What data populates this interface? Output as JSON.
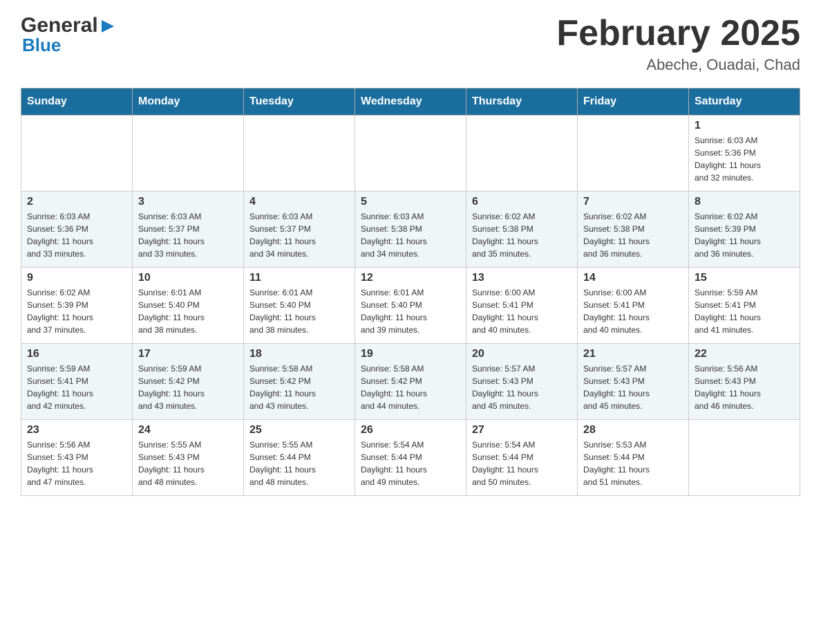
{
  "header": {
    "logo_general": "General",
    "logo_blue": "Blue",
    "title": "February 2025",
    "subtitle": "Abeche, Ouadai, Chad"
  },
  "days_of_week": [
    "Sunday",
    "Monday",
    "Tuesday",
    "Wednesday",
    "Thursday",
    "Friday",
    "Saturday"
  ],
  "weeks": [
    {
      "days": [
        {
          "number": "",
          "info": ""
        },
        {
          "number": "",
          "info": ""
        },
        {
          "number": "",
          "info": ""
        },
        {
          "number": "",
          "info": ""
        },
        {
          "number": "",
          "info": ""
        },
        {
          "number": "",
          "info": ""
        },
        {
          "number": "1",
          "info": "Sunrise: 6:03 AM\nSunset: 5:36 PM\nDaylight: 11 hours\nand 32 minutes."
        }
      ]
    },
    {
      "days": [
        {
          "number": "2",
          "info": "Sunrise: 6:03 AM\nSunset: 5:36 PM\nDaylight: 11 hours\nand 33 minutes."
        },
        {
          "number": "3",
          "info": "Sunrise: 6:03 AM\nSunset: 5:37 PM\nDaylight: 11 hours\nand 33 minutes."
        },
        {
          "number": "4",
          "info": "Sunrise: 6:03 AM\nSunset: 5:37 PM\nDaylight: 11 hours\nand 34 minutes."
        },
        {
          "number": "5",
          "info": "Sunrise: 6:03 AM\nSunset: 5:38 PM\nDaylight: 11 hours\nand 34 minutes."
        },
        {
          "number": "6",
          "info": "Sunrise: 6:02 AM\nSunset: 5:38 PM\nDaylight: 11 hours\nand 35 minutes."
        },
        {
          "number": "7",
          "info": "Sunrise: 6:02 AM\nSunset: 5:38 PM\nDaylight: 11 hours\nand 36 minutes."
        },
        {
          "number": "8",
          "info": "Sunrise: 6:02 AM\nSunset: 5:39 PM\nDaylight: 11 hours\nand 36 minutes."
        }
      ]
    },
    {
      "days": [
        {
          "number": "9",
          "info": "Sunrise: 6:02 AM\nSunset: 5:39 PM\nDaylight: 11 hours\nand 37 minutes."
        },
        {
          "number": "10",
          "info": "Sunrise: 6:01 AM\nSunset: 5:40 PM\nDaylight: 11 hours\nand 38 minutes."
        },
        {
          "number": "11",
          "info": "Sunrise: 6:01 AM\nSunset: 5:40 PM\nDaylight: 11 hours\nand 38 minutes."
        },
        {
          "number": "12",
          "info": "Sunrise: 6:01 AM\nSunset: 5:40 PM\nDaylight: 11 hours\nand 39 minutes."
        },
        {
          "number": "13",
          "info": "Sunrise: 6:00 AM\nSunset: 5:41 PM\nDaylight: 11 hours\nand 40 minutes."
        },
        {
          "number": "14",
          "info": "Sunrise: 6:00 AM\nSunset: 5:41 PM\nDaylight: 11 hours\nand 40 minutes."
        },
        {
          "number": "15",
          "info": "Sunrise: 5:59 AM\nSunset: 5:41 PM\nDaylight: 11 hours\nand 41 minutes."
        }
      ]
    },
    {
      "days": [
        {
          "number": "16",
          "info": "Sunrise: 5:59 AM\nSunset: 5:41 PM\nDaylight: 11 hours\nand 42 minutes."
        },
        {
          "number": "17",
          "info": "Sunrise: 5:59 AM\nSunset: 5:42 PM\nDaylight: 11 hours\nand 43 minutes."
        },
        {
          "number": "18",
          "info": "Sunrise: 5:58 AM\nSunset: 5:42 PM\nDaylight: 11 hours\nand 43 minutes."
        },
        {
          "number": "19",
          "info": "Sunrise: 5:58 AM\nSunset: 5:42 PM\nDaylight: 11 hours\nand 44 minutes."
        },
        {
          "number": "20",
          "info": "Sunrise: 5:57 AM\nSunset: 5:43 PM\nDaylight: 11 hours\nand 45 minutes."
        },
        {
          "number": "21",
          "info": "Sunrise: 5:57 AM\nSunset: 5:43 PM\nDaylight: 11 hours\nand 45 minutes."
        },
        {
          "number": "22",
          "info": "Sunrise: 5:56 AM\nSunset: 5:43 PM\nDaylight: 11 hours\nand 46 minutes."
        }
      ]
    },
    {
      "days": [
        {
          "number": "23",
          "info": "Sunrise: 5:56 AM\nSunset: 5:43 PM\nDaylight: 11 hours\nand 47 minutes."
        },
        {
          "number": "24",
          "info": "Sunrise: 5:55 AM\nSunset: 5:43 PM\nDaylight: 11 hours\nand 48 minutes."
        },
        {
          "number": "25",
          "info": "Sunrise: 5:55 AM\nSunset: 5:44 PM\nDaylight: 11 hours\nand 48 minutes."
        },
        {
          "number": "26",
          "info": "Sunrise: 5:54 AM\nSunset: 5:44 PM\nDaylight: 11 hours\nand 49 minutes."
        },
        {
          "number": "27",
          "info": "Sunrise: 5:54 AM\nSunset: 5:44 PM\nDaylight: 11 hours\nand 50 minutes."
        },
        {
          "number": "28",
          "info": "Sunrise: 5:53 AM\nSunset: 5:44 PM\nDaylight: 11 hours\nand 51 minutes."
        },
        {
          "number": "",
          "info": ""
        }
      ]
    }
  ]
}
